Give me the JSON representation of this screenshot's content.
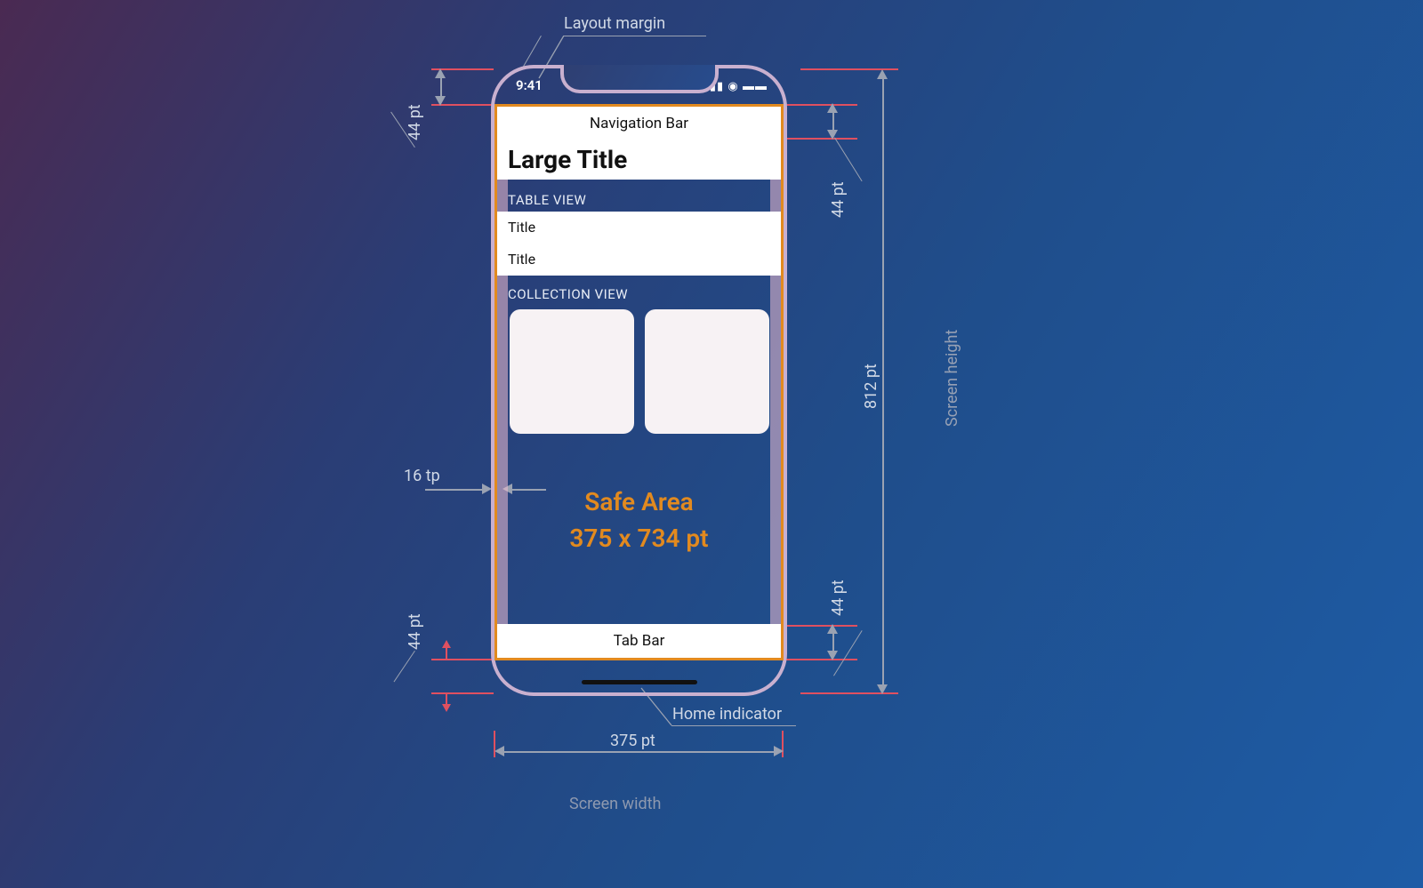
{
  "annotations": {
    "layout_margin": "Layout margin",
    "home_indicator": "Home indicator",
    "screen_width": "Screen width",
    "screen_height": "Screen height",
    "width_value": "375 pt",
    "height_value": "812 pt",
    "status_height": "44 pt",
    "nav_height": "44 pt",
    "tab_height": "44 pt",
    "homebar_height": "44 pt",
    "margin_value": "16 tp"
  },
  "phone": {
    "status_time": "9:41",
    "nav_bar": "Navigation Bar",
    "large_title": "Large Title",
    "table_header": "TABLE VIEW",
    "row1": "Title",
    "row2": "Title",
    "collection_header": "COLLECTION VIEW",
    "safe_area_line1": "Safe Area",
    "safe_area_line2": "375 x 734 pt",
    "tab_bar": "Tab Bar"
  }
}
